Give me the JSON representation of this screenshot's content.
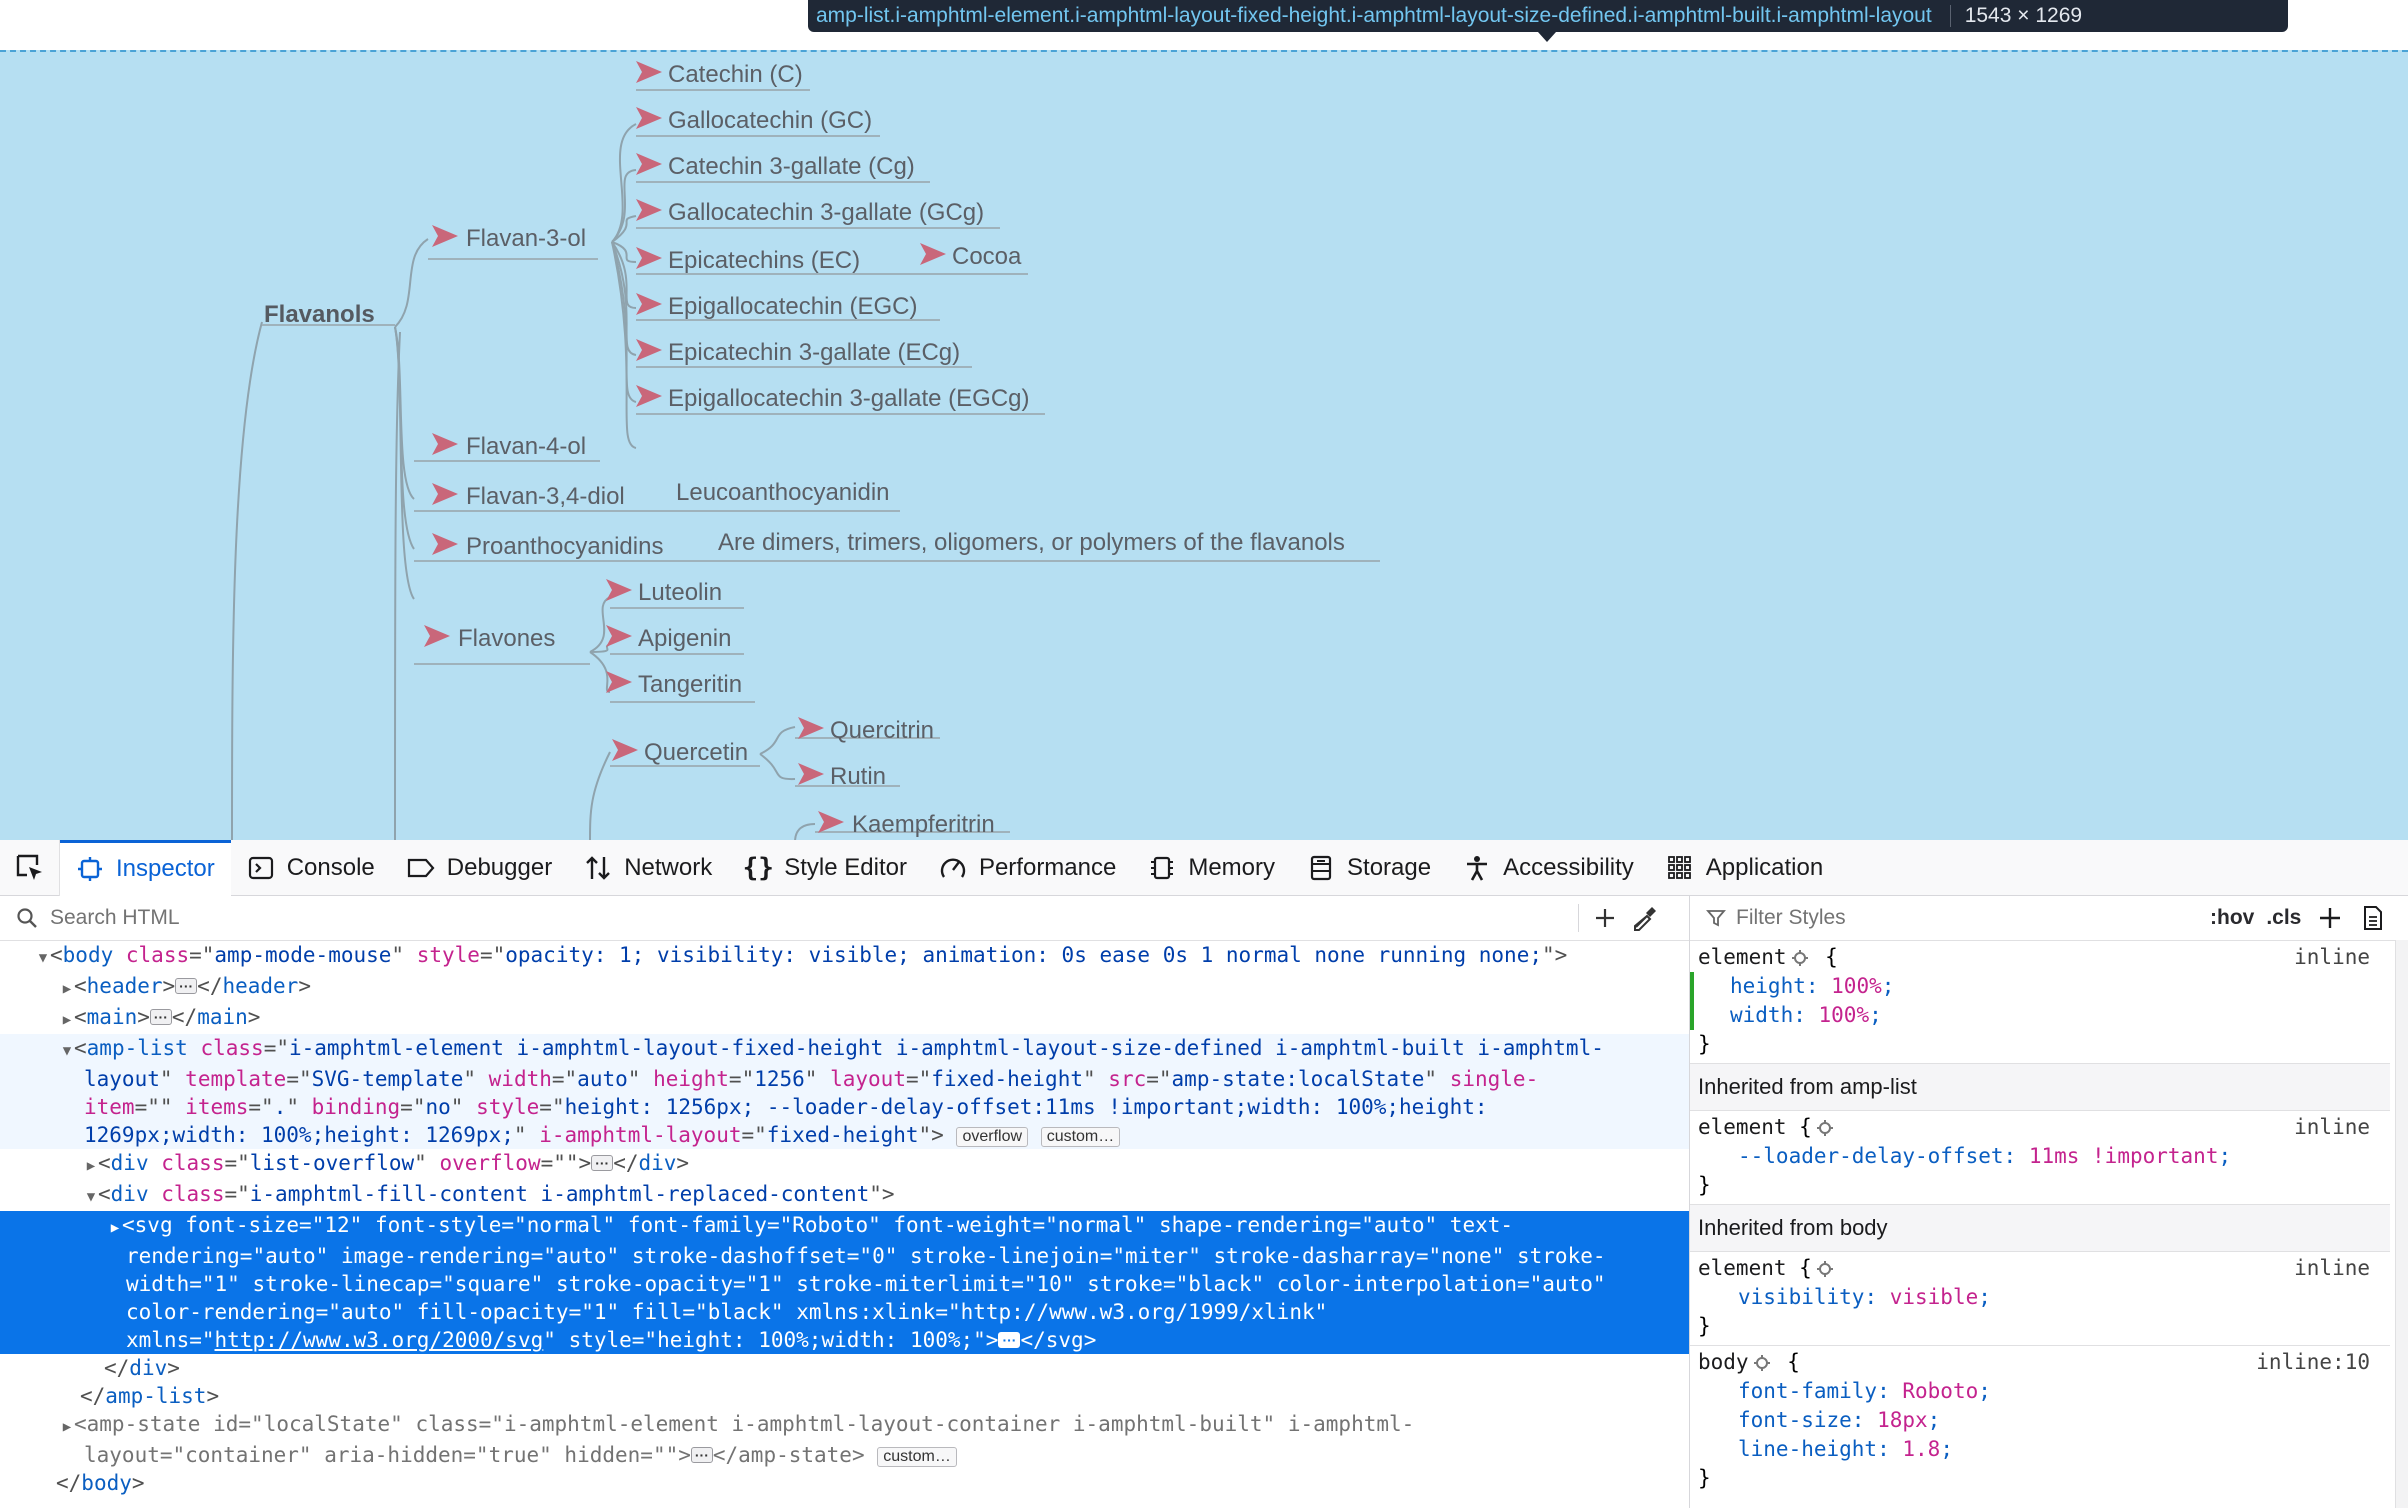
{
  "tooltip": {
    "selector": "amp-list.i-amphtml-element.i-amphtml-layout-fixed-height.i-amphtml-layout-size-defined.i-amphtml-built.i-amphtml-layout",
    "dimensions": "1543 × 1269"
  },
  "mindmap": {
    "root": "Flavanols",
    "flavan3ol": "Flavan-3-ol",
    "flavan3ol_children": [
      "Catechin (C)",
      "Gallocatechin (GC)",
      "Catechin 3-gallate (Cg)",
      "Gallocatechin 3-gallate (GCg)",
      "Epicatechins (EC)",
      "Epigallocatechin (EGC)",
      "Epicatechin 3-gallate (ECg)",
      "Epigallocatechin 3-gallate (EGCg)"
    ],
    "cocoa": "Cocoa",
    "flavan4ol": "Flavan-4-ol",
    "flavan34diol": "Flavan-3,4-diol",
    "leucoanthocyanidin": "Leucoanthocyanidin",
    "proanthocyanidins": "Proanthocyanidins",
    "proantho_note": "Are dimers, trimers, oligomers, or polymers of the flavanols",
    "flavones": "Flavones",
    "flavones_children": [
      "Luteolin",
      "Apigenin",
      "Tangeritin"
    ],
    "quercetin": "Quercetin",
    "quercetin_children": [
      "Quercitrin",
      "Rutin"
    ],
    "kaempferitrin": "Kaempferitrin"
  },
  "devtools": {
    "tabs": [
      "Inspector",
      "Console",
      "Debugger",
      "Network",
      "Style Editor",
      "Performance",
      "Memory",
      "Storage",
      "Accessibility",
      "Application"
    ],
    "search_placeholder": "Search HTML",
    "filter_placeholder": "Filter Styles",
    "hov": ":hov",
    "cls": ".cls",
    "badges": {
      "overflow": "overflow",
      "custom": "custom…"
    },
    "rules": {
      "r1_selector": "element",
      "r1_source": "inline",
      "r1_props": [
        {
          "name": "height",
          "value": "100%"
        },
        {
          "name": "width",
          "value": "100%"
        }
      ],
      "inherited_amp_list": "Inherited from amp-list",
      "r2_selector": "element",
      "r2_source": "inline",
      "r2_prop": {
        "name": "--loader-delay-offset",
        "value": "11ms !important"
      },
      "inherited_body": "Inherited from body",
      "r3_selector": "element",
      "r3_source": "inline",
      "r3_prop": {
        "name": "visibility",
        "value": "visible"
      },
      "r4_selector": "body",
      "r4_source": "inline:10",
      "r4_props": [
        {
          "name": "font-family",
          "value": "Roboto"
        },
        {
          "name": "font-size",
          "value": "18px"
        },
        {
          "name": "line-height",
          "value": "1.8"
        }
      ]
    }
  },
  "colors": {
    "canvas": "#b6dff2",
    "accent": "#0a74e8",
    "arrow": "#c9677a"
  }
}
